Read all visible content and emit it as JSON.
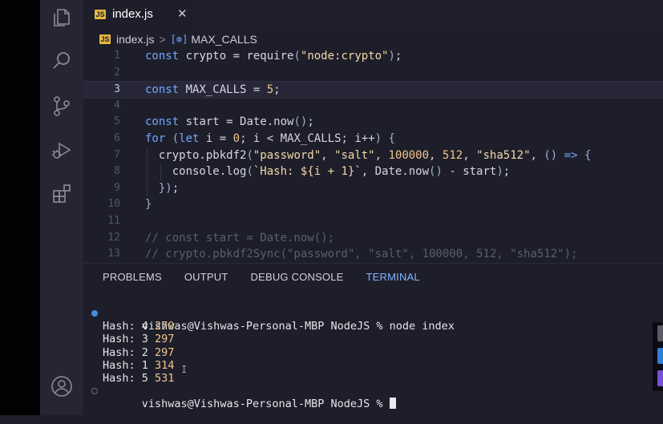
{
  "activity_bar": {
    "icons": [
      "files-icon",
      "search-icon",
      "source-control-icon",
      "run-debug-icon",
      "extensions-icon",
      "account-icon"
    ]
  },
  "tab": {
    "label": "index.js",
    "close": "✕",
    "badge": "JS"
  },
  "breadcrumb": {
    "file": "index.js",
    "separator": ">",
    "symbol": "MAX_CALLS"
  },
  "editor": {
    "current_line": 3,
    "lines": [
      {
        "n": "1",
        "text": "const crypto = require(\"node:crypto\");"
      },
      {
        "n": "2",
        "text": ""
      },
      {
        "n": "3",
        "text": "const MAX_CALLS = 5;"
      },
      {
        "n": "4",
        "text": ""
      },
      {
        "n": "5",
        "text": "const start = Date.now();"
      },
      {
        "n": "6",
        "text": "for (let i = 0; i < MAX_CALLS; i++) {"
      },
      {
        "n": "7",
        "text": "  crypto.pbkdf2(\"password\", \"salt\", 100000, 512, \"sha512\", () => {"
      },
      {
        "n": "8",
        "text": "    console.log(`Hash: ${i + 1}`, Date.now() - start);"
      },
      {
        "n": "9",
        "text": "  });"
      },
      {
        "n": "10",
        "text": "}"
      },
      {
        "n": "11",
        "text": ""
      },
      {
        "n": "12",
        "text": "// const start = Date.now();"
      },
      {
        "n": "13",
        "text": "// crypto.pbkdf2Sync(\"password\", \"salt\", 100000, 512, \"sha512\");"
      }
    ]
  },
  "panel": {
    "tabs": [
      "PROBLEMS",
      "OUTPUT",
      "DEBUG CONSOLE",
      "TERMINAL"
    ],
    "active_tab": "TERMINAL"
  },
  "terminal": {
    "prompt1": "vishwas@Vishwas-Personal-MBP NodeJS % node index",
    "outputs": [
      {
        "label": "Hash: 4",
        "value": "270"
      },
      {
        "label": "Hash: 3",
        "value": "297"
      },
      {
        "label": "Hash: 2",
        "value": "297"
      },
      {
        "label": "Hash: 1",
        "value": "314"
      },
      {
        "label": "Hash: 5",
        "value": "531"
      }
    ],
    "prompt2": "vishwas@Vishwas-Personal-MBP NodeJS % ",
    "ibeam": "I"
  },
  "colors": {
    "accent": "#3f8fe0",
    "js_badge": "#e5b93c",
    "number": "#f0c68a"
  }
}
